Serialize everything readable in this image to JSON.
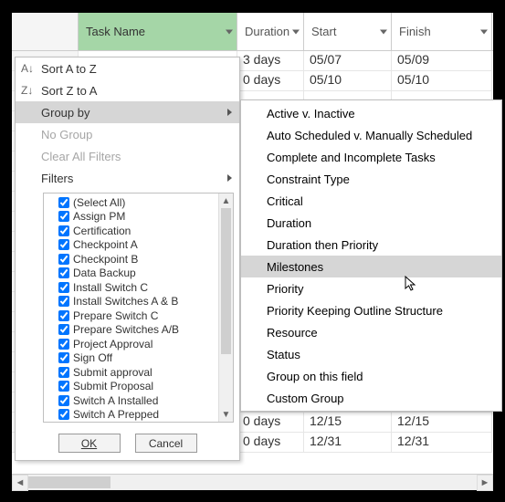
{
  "columns": {
    "taskname": "Task Name",
    "duration": "Duration",
    "start": "Start",
    "finish": "Finish"
  },
  "rows": [
    {
      "duration": "3 days",
      "start": "05/07",
      "finish": "05/09"
    },
    {
      "duration": "0 days",
      "start": "05/10",
      "finish": "05/10"
    },
    {
      "duration": "",
      "start": "",
      "finish": ""
    },
    {
      "duration": "",
      "start": "",
      "finish": ""
    },
    {
      "duration": "",
      "start": "",
      "finish": ""
    },
    {
      "duration": "",
      "start": "",
      "finish": ""
    },
    {
      "duration": "",
      "start": "",
      "finish": ""
    },
    {
      "duration": "",
      "start": "",
      "finish": ""
    },
    {
      "duration": "",
      "start": "",
      "finish": ""
    },
    {
      "duration": "",
      "start": "",
      "finish": ""
    },
    {
      "duration": "",
      "start": "",
      "finish": ""
    },
    {
      "duration": "",
      "start": "",
      "finish": ""
    },
    {
      "duration": "",
      "start": "",
      "finish": ""
    },
    {
      "duration": "",
      "start": "",
      "finish": ""
    },
    {
      "duration": "",
      "start": "",
      "finish": ""
    },
    {
      "duration": "",
      "start": "",
      "finish": ""
    },
    {
      "duration": "",
      "start": "",
      "finish": ""
    },
    {
      "duration": "",
      "start": "",
      "finish": ""
    },
    {
      "duration": "0 days",
      "start": "12/15",
      "finish": "12/15"
    },
    {
      "duration": "0 days",
      "start": "12/31",
      "finish": "12/31"
    }
  ],
  "menu": {
    "sort_az": "Sort A to Z",
    "sort_za": "Sort Z to A",
    "group_by": "Group by",
    "no_group": "No Group",
    "clear_filters": "Clear All Filters",
    "filters": "Filters",
    "ok": "OK",
    "cancel": "Cancel"
  },
  "filter_items": [
    "(Select All)",
    "Assign PM",
    "Certification",
    "Checkpoint A",
    "Checkpoint B",
    "Data Backup",
    "Install Switch C",
    "Install Switches A & B",
    "Prepare Switch C",
    "Prepare Switches A/B",
    "Project Approval",
    "Sign Off",
    "Submit approval",
    "Submit Proposal",
    "Switch A Installed",
    "Switch A Prepped"
  ],
  "submenu": [
    "Active v. Inactive",
    "Auto Scheduled v. Manually Scheduled",
    "Complete and Incomplete Tasks",
    "Constraint Type",
    "Critical",
    "Duration",
    "Duration then Priority",
    "Milestones",
    "Priority",
    "Priority Keeping Outline Structure",
    "Resource",
    "Status",
    "Group on this field",
    "Custom Group"
  ],
  "submenu_selected": 7
}
